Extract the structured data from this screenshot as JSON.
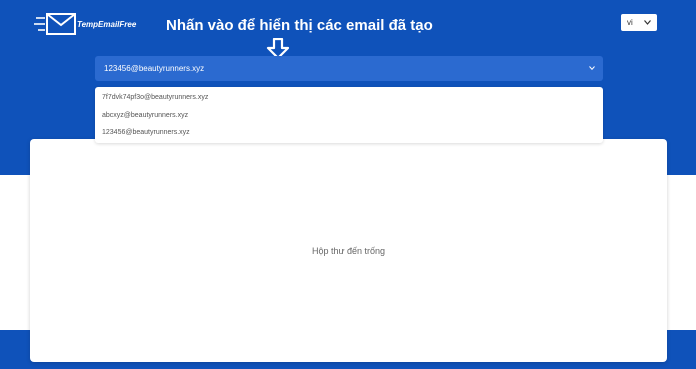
{
  "header": {
    "logo_text": "TempEmailFree",
    "language": {
      "selected": "vi"
    }
  },
  "annotation": {
    "text": "Nhấn vào để hiển thị các email đã tạo",
    "arrow_icon": "down-arrow-icon"
  },
  "email_select": {
    "value": "123456@beautyrunners.xyz",
    "options": [
      "7f7dvk74pf3o@beautyrunners.xyz",
      "abcxyz@beautyrunners.xyz",
      "123456@beautyrunners.xyz"
    ]
  },
  "inbox": {
    "empty_text": "Hộp thư đến trống"
  },
  "colors": {
    "brand_blue": "#0f52ba",
    "select_blue": "#2b6ad0"
  }
}
